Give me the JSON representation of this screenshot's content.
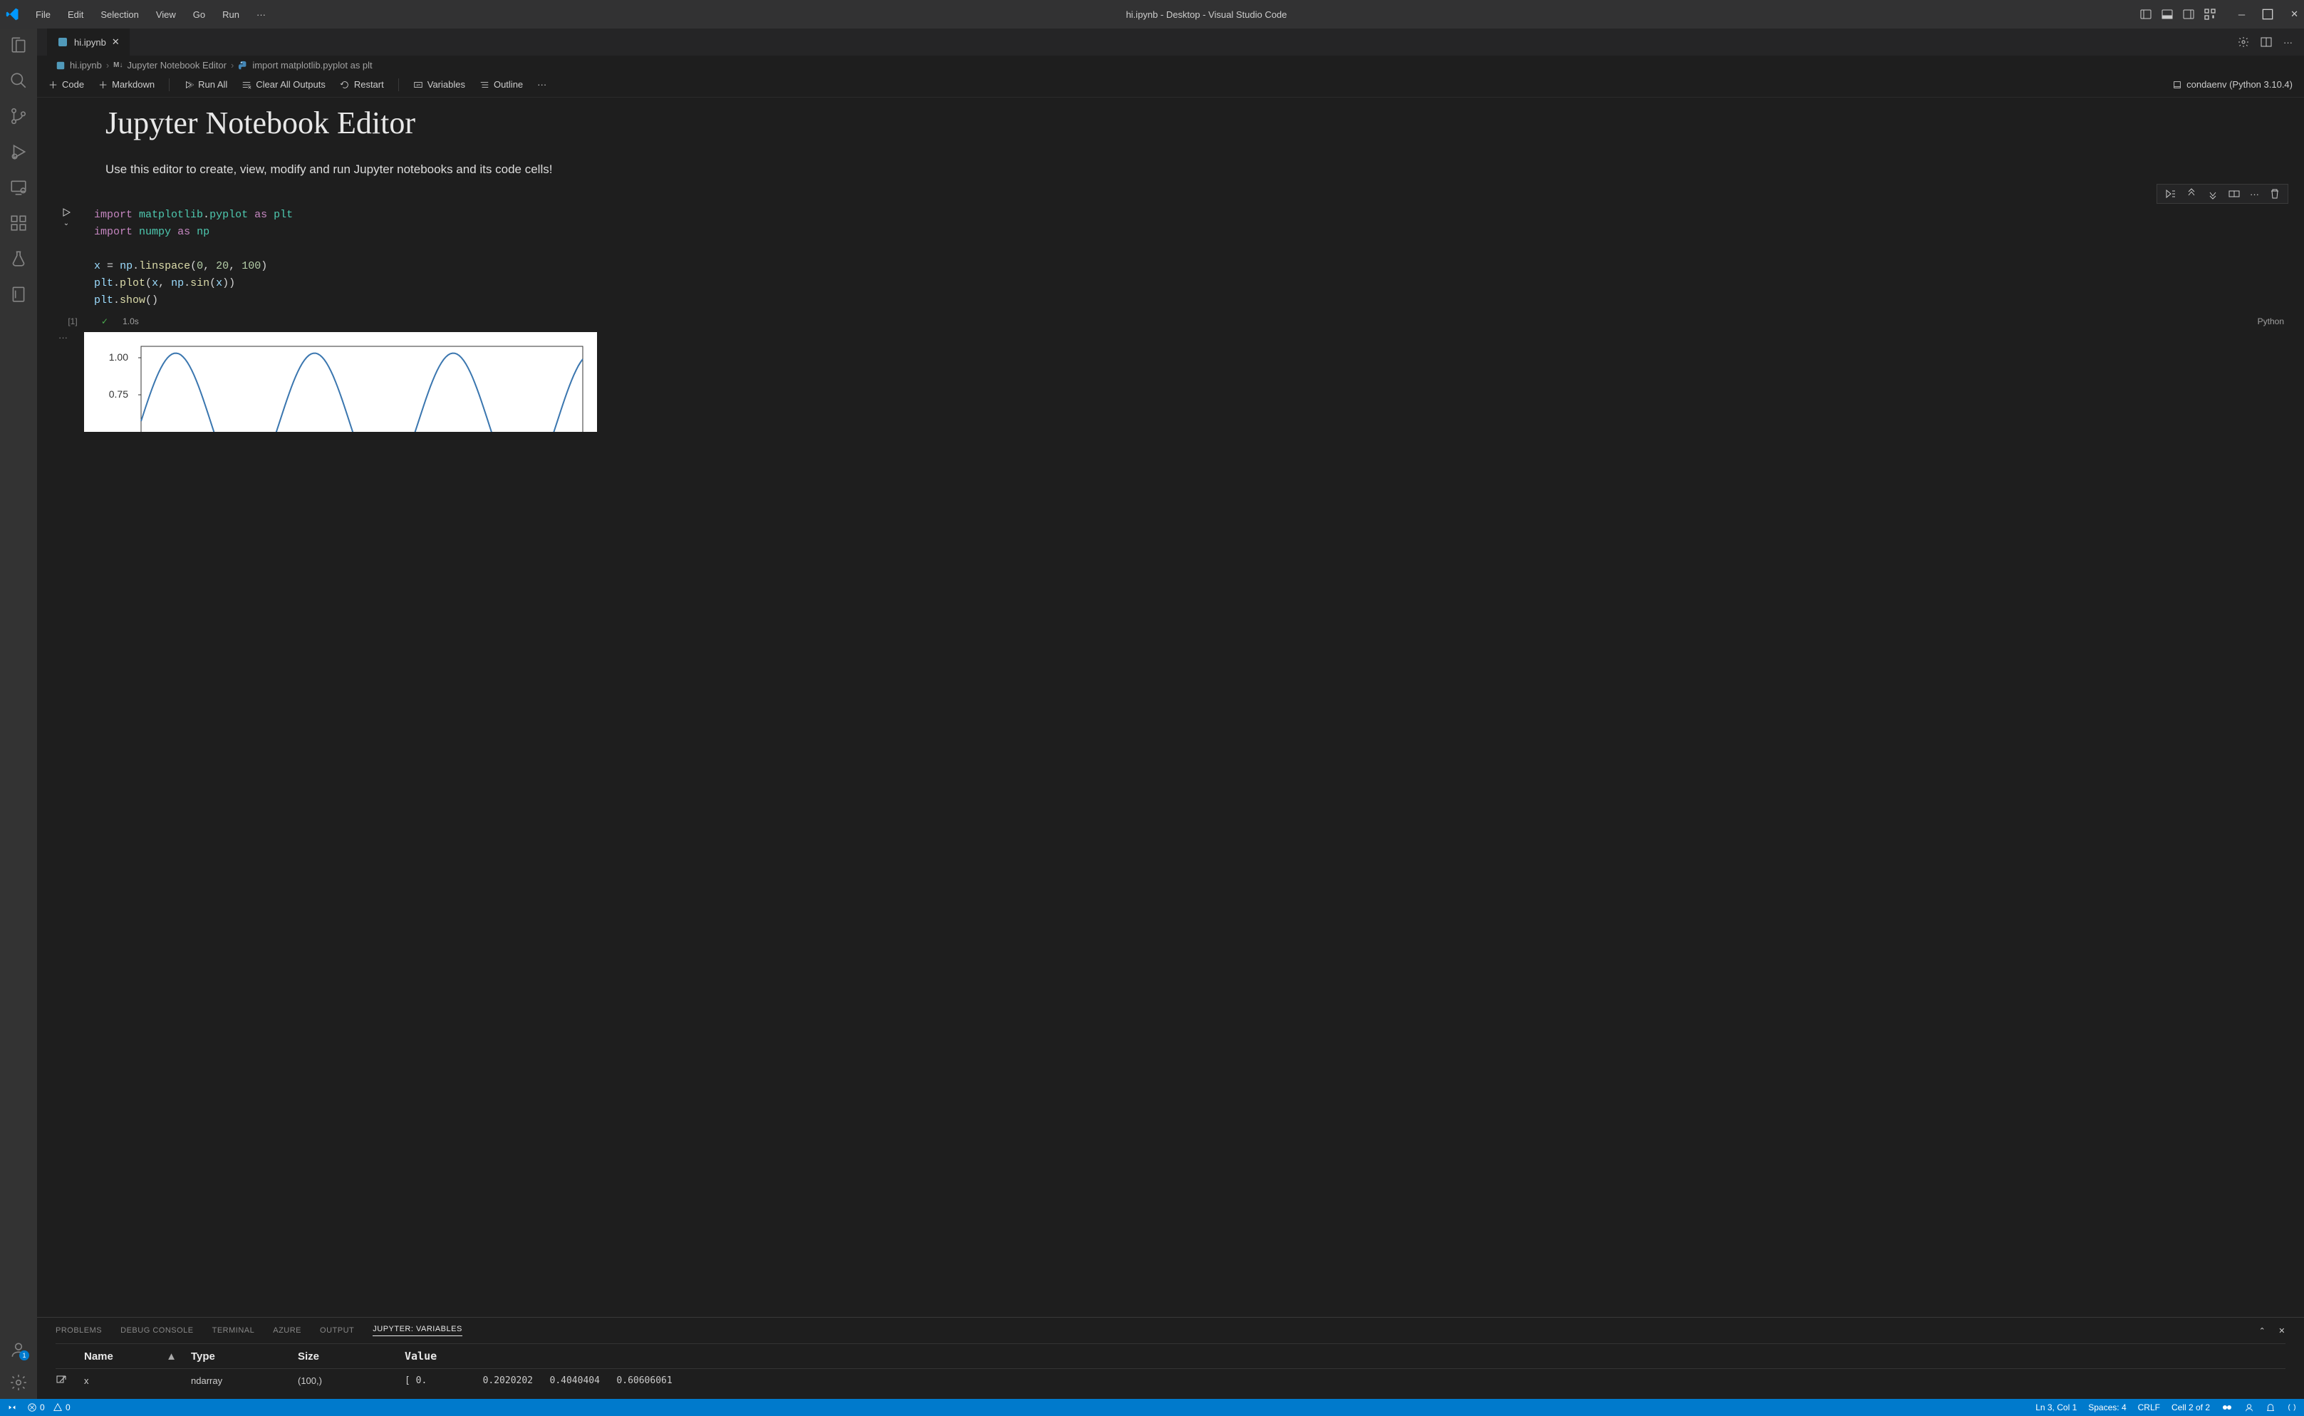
{
  "menubar": [
    "File",
    "Edit",
    "Selection",
    "View",
    "Go",
    "Run"
  ],
  "window_title": "hi.ipynb - Desktop - Visual Studio Code",
  "tab": {
    "filename": "hi.ipynb"
  },
  "breadcrumb": {
    "file": "hi.ipynb",
    "editor": "Jupyter Notebook Editor",
    "editor_prefix": "M↓",
    "cell": "import matplotlib.pyplot as plt"
  },
  "nb_toolbar": {
    "code": "Code",
    "markdown": "Markdown",
    "run_all": "Run All",
    "clear_outputs": "Clear All Outputs",
    "restart": "Restart",
    "variables": "Variables",
    "outline": "Outline",
    "kernel": "condaenv (Python 3.10.4)"
  },
  "md_cell": {
    "title": "Jupyter Notebook Editor",
    "body": "Use this editor to create, view, modify and run Jupyter notebooks and its code cells!"
  },
  "code_cell": {
    "status": {
      "exec_count": "[1]",
      "duration": "1.0s",
      "language": "Python"
    }
  },
  "panel": {
    "tabs": [
      "PROBLEMS",
      "DEBUG CONSOLE",
      "TERMINAL",
      "AZURE",
      "OUTPUT",
      "JUPYTER: VARIABLES"
    ],
    "active_tab_index": 5,
    "headers": {
      "name": "Name",
      "type": "Type",
      "size": "Size",
      "value": "Value"
    },
    "row": {
      "name": "x",
      "type": "ndarray",
      "size": "(100,)",
      "value": "[ 0.          0.2020202   0.4040404   0.60606061"
    }
  },
  "statusbar": {
    "errors": "0",
    "warnings": "0",
    "ln_col": "Ln 3, Col 1",
    "spaces": "Spaces: 4",
    "encoding": "CRLF",
    "cell": "Cell 2 of 2"
  },
  "account_badge": "1",
  "chart_data": {
    "type": "line",
    "function": "sin(x)",
    "x_range": [
      0,
      20
    ],
    "y_ticks_visible": [
      1.0,
      0.75
    ],
    "ylim": [
      -1.1,
      1.1
    ],
    "note": "y = sin(x) on [0, 20], only top portion of plot visible in UI"
  }
}
